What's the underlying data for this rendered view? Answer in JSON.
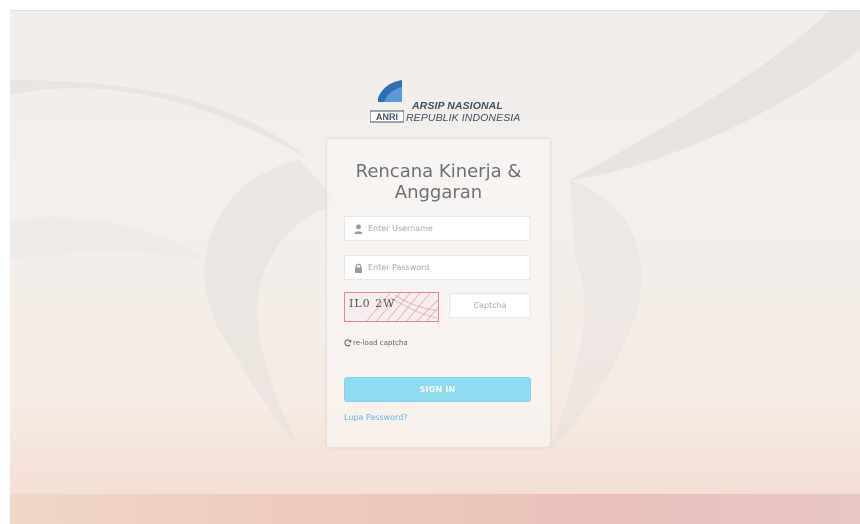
{
  "branding": {
    "logo_mark_text": "ANRI",
    "line1": "ARSIP NASIONAL",
    "line2": "REPUBLIK INDONESIA"
  },
  "login": {
    "title": "Rencana Kinerja & Anggaran",
    "username": {
      "placeholder": "Enter Username",
      "value": "",
      "icon": "user-icon"
    },
    "password": {
      "placeholder": "Enter Password",
      "value": "",
      "icon": "lock-icon"
    },
    "captcha": {
      "image_text": "IL0 2W",
      "input_placeholder": "Captcha",
      "reload_label": "re-load captcha",
      "reload_icon": "refresh-icon"
    },
    "sign_in_label": "SIGN IN",
    "forgot_label": "Lupa Password?"
  },
  "colors": {
    "primary_button": "#8fdcf2",
    "link": "#5fb7de",
    "captcha_border": "#d98a92",
    "brand_text": "#3f4f63",
    "logo_blue": "#2f6fb7"
  }
}
